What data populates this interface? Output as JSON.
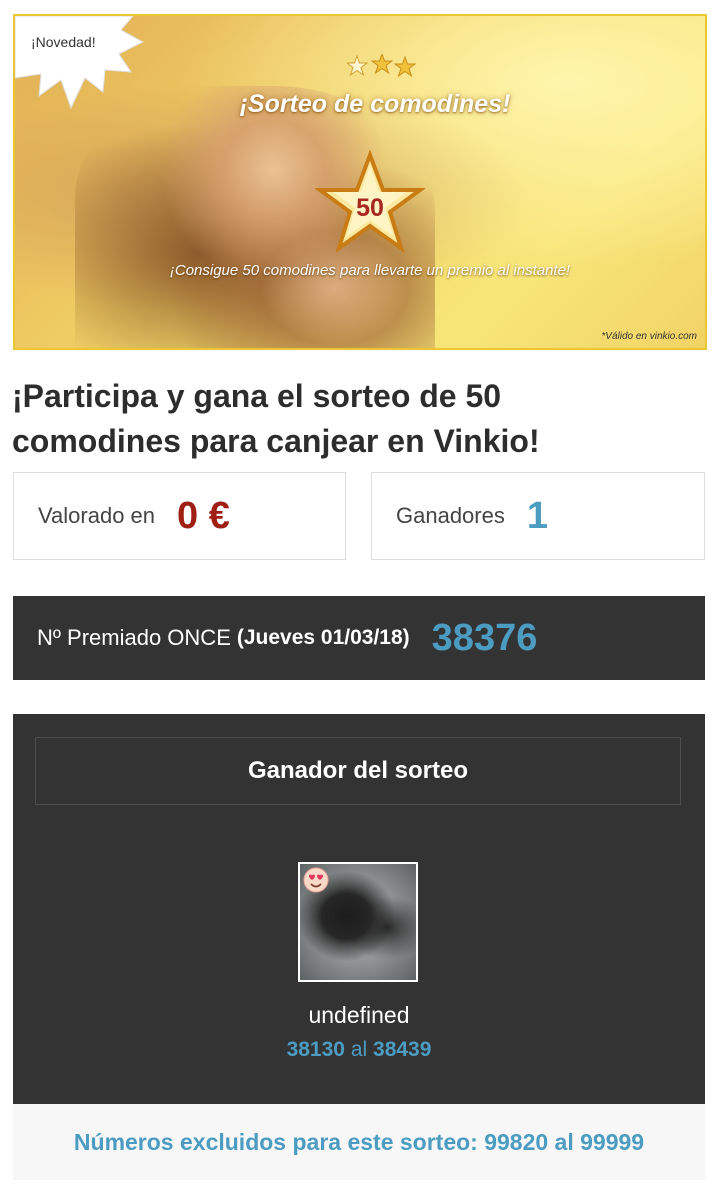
{
  "banner": {
    "badge": "¡Novedad!",
    "title": "¡Sorteo de comodines!",
    "star_number": "50",
    "subtitle": "¡Consigue 50 comodines para llevarte un premio al instante!",
    "note": "*Válido en vinkio.com"
  },
  "heading": "¡Participa y gana el sorteo de 50 comodines para canjear en Vinkio!",
  "value_box": {
    "label": "Valorado en",
    "amount": "0 €"
  },
  "winners_box": {
    "label": "Ganadores",
    "count": "1"
  },
  "once": {
    "label": "Nº Premiado ONCE",
    "date": "(Jueves 01/03/18)",
    "number": "38376"
  },
  "winner": {
    "title": "Ganador del sorteo",
    "name": "undefined",
    "range_from": "38130",
    "range_sep": "al",
    "range_to": "38439"
  },
  "excluded": "Números excluidos para este sorteo: 99820 al 99999",
  "colors": {
    "accent_blue": "#4c9cc2",
    "price_red": "#a01f15",
    "dark_panel": "#333333"
  }
}
